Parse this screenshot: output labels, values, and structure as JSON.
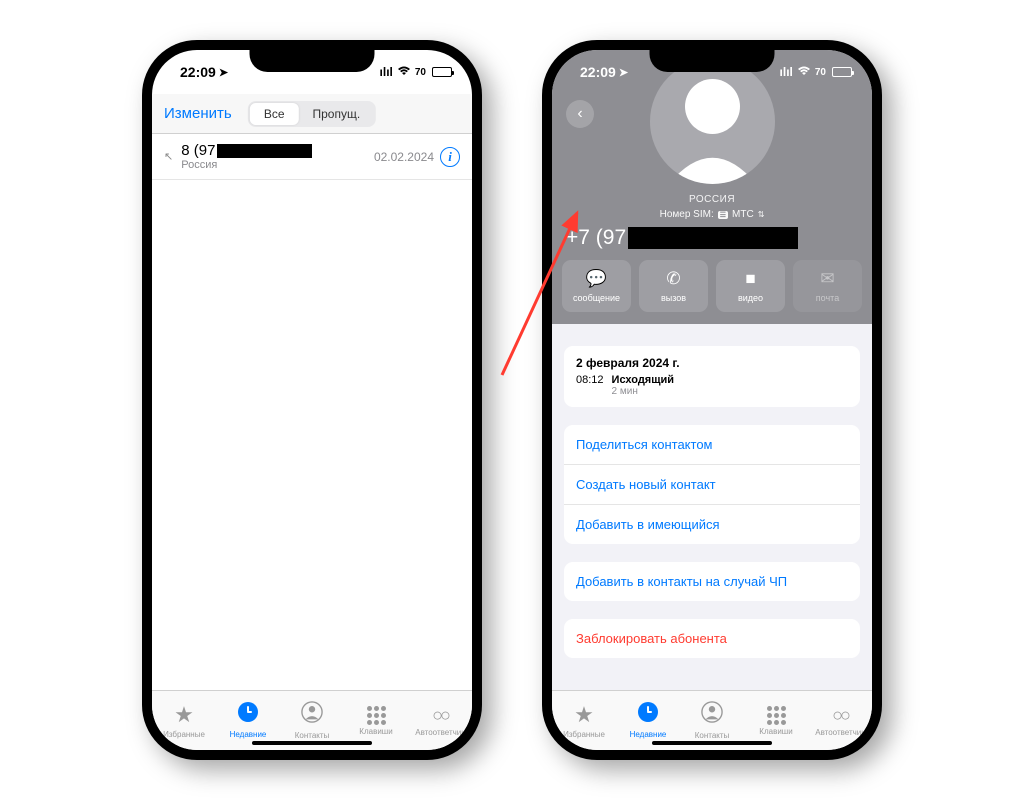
{
  "status": {
    "time": "22:09",
    "battery": "70"
  },
  "phone1": {
    "edit": "Изменить",
    "seg_all": "Все",
    "seg_missed": "Пропущ.",
    "call": {
      "number": "8 (97",
      "location": "Россия",
      "date": "02.02.2024"
    }
  },
  "phone2": {
    "country": "РОССИЯ",
    "sim_label": "Номер SIM:",
    "sim_carrier": "МТС",
    "phone_prefix": "+7 (97",
    "actions": {
      "message": "сообщение",
      "call": "вызов",
      "video": "видео",
      "mail": "почта"
    },
    "log": {
      "date": "2 февраля 2024 г.",
      "time": "08:12",
      "type": "Исходящий",
      "duration": "2 мин"
    },
    "options": {
      "share": "Поделиться контактом",
      "create": "Создать новый контакт",
      "add_existing": "Добавить в имеющийся",
      "emergency": "Добавить в контакты на случай ЧП",
      "block": "Заблокировать абонента"
    }
  },
  "tabs": {
    "favorites": "Избранные",
    "recents": "Недавние",
    "contacts": "Контакты",
    "keypad": "Клавиши",
    "voicemail": "Автоответчик"
  }
}
